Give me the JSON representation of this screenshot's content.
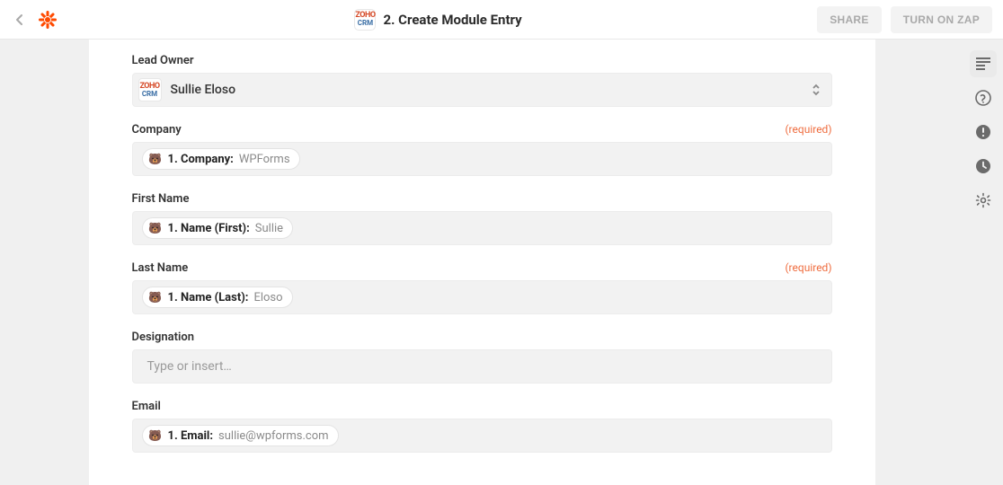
{
  "header": {
    "step_title": "2. Create Module Entry",
    "share_label": "SHARE",
    "turn_on_label": "TURN ON ZAP"
  },
  "rail": {
    "items": [
      "outline",
      "help",
      "alerts",
      "history",
      "settings"
    ]
  },
  "form": {
    "lead_owner": {
      "label": "Lead Owner",
      "value": "Sullie Eloso"
    },
    "company": {
      "label": "Company",
      "required_text": "(required)",
      "pill_label": "1. Company:",
      "pill_value": "WPForms"
    },
    "first_name": {
      "label": "First Name",
      "pill_label": "1. Name (First):",
      "pill_value": "Sullie"
    },
    "last_name": {
      "label": "Last Name",
      "required_text": "(required)",
      "pill_label": "1. Name (Last):",
      "pill_value": "Eloso"
    },
    "designation": {
      "label": "Designation",
      "placeholder": "Type or insert…"
    },
    "email": {
      "label": "Email",
      "pill_label": "1. Email:",
      "pill_value": "sullie@wpforms.com"
    }
  }
}
